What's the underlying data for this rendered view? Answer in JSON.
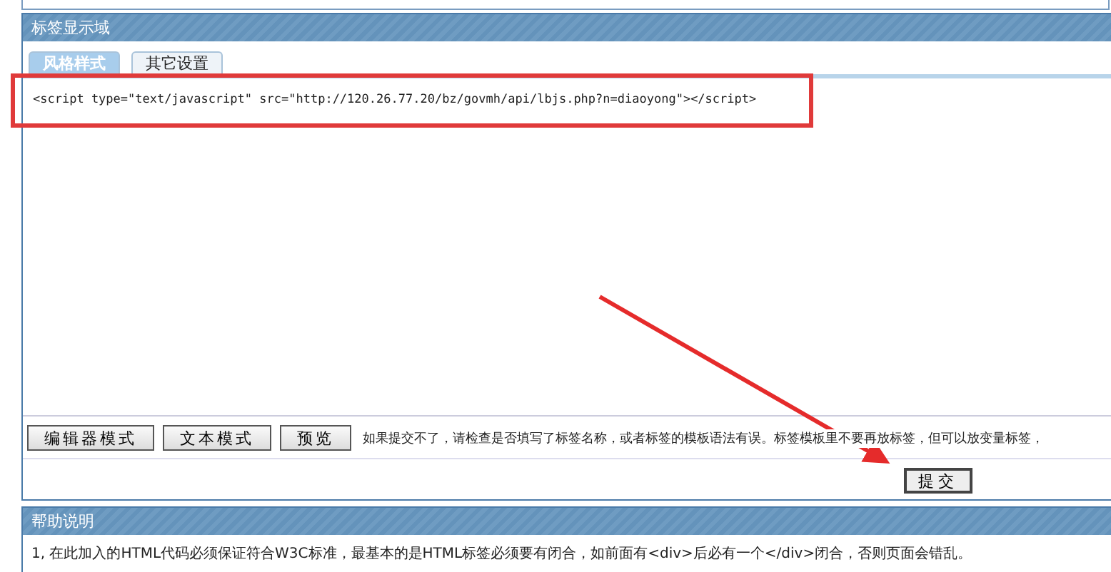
{
  "panel": {
    "title": "标签显示域"
  },
  "tabs": [
    {
      "label": "风格样式",
      "selected": true
    },
    {
      "label": "其它设置",
      "selected": false
    }
  ],
  "editor": {
    "value": "<script type=\"text/javascript\" src=\"http://120.26.77.20/bz/govmh/api/lbjs.php?n=diaoyong\"></script>"
  },
  "mode_buttons": [
    "编辑器模式",
    "文本模式",
    "预览"
  ],
  "hint": "如果提交不了，请检查是否填写了标签名称，或者标签的模板语法有误。标签模板里不要再放标签，但可以放变量标签，",
  "submit_button": "提交",
  "help": {
    "title": "帮助说明",
    "items": [
      "1, 在此加入的HTML代码必须保证符合W3C标准，最基本的是HTML标签必须要有闭合，如前面有<div>后必有一个</div>闭合，否则页面会错乱。"
    ]
  }
}
